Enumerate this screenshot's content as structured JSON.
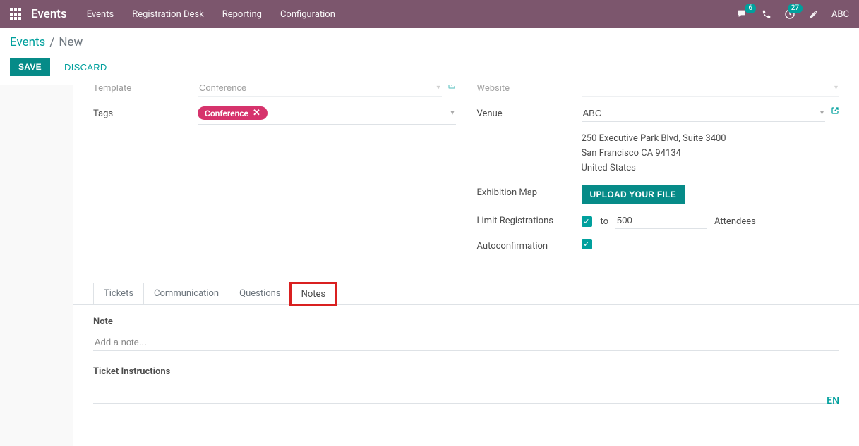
{
  "nav": {
    "brand": "Events",
    "links": [
      "Events",
      "Registration Desk",
      "Reporting",
      "Configuration"
    ],
    "chat_badge": "6",
    "activity_badge": "27",
    "user": "ABC"
  },
  "breadcrumb": {
    "root": "Events",
    "current": "New"
  },
  "actions": {
    "save": "SAVE",
    "discard": "DISCARD"
  },
  "form": {
    "template_label": "Template",
    "template_value": "Conference",
    "tags_label": "Tags",
    "tag_value": "Conference",
    "website_label": "Website",
    "venue_label": "Venue",
    "venue_value": "ABC",
    "addr1": "250 Executive Park Blvd, Suite 3400",
    "addr2": "San Francisco CA 94134",
    "addr3": "United States",
    "exhibition_label": "Exhibition Map",
    "upload_btn": "UPLOAD YOUR FILE",
    "limit_label": "Limit Registrations",
    "limit_to": "to",
    "limit_value": "500",
    "limit_suffix": "Attendees",
    "autoconfirm_label": "Autoconfirmation"
  },
  "tabs": {
    "tickets": "Tickets",
    "communication": "Communication",
    "questions": "Questions",
    "notes": "Notes"
  },
  "notes": {
    "note_title": "Note",
    "note_placeholder": "Add a note...",
    "ticket_instructions_title": "Ticket Instructions",
    "lang": "EN"
  }
}
